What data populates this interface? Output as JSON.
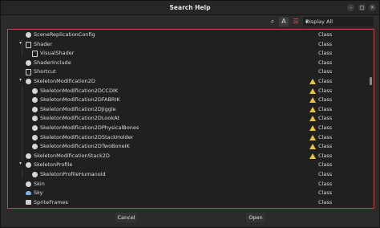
{
  "window": {
    "title": "Search Help",
    "minimize": "–",
    "maximize": "□",
    "close": "×"
  },
  "toolbar": {
    "display_value": "Display All",
    "arrow": "▾"
  },
  "rows": [
    {
      "label": "SceneReplicationConfig",
      "type": "Class",
      "warn": false,
      "icon": "node"
    },
    {
      "label": "Shader",
      "type": "Class",
      "warn": false,
      "icon": "doc",
      "expander": "▾"
    },
    {
      "label": "VisualShader",
      "type": "Class",
      "warn": false,
      "icon": "doc"
    },
    {
      "label": "ShaderInclude",
      "type": "Class",
      "warn": false,
      "icon": "node"
    },
    {
      "label": "Shortcut",
      "type": "Class",
      "warn": false,
      "icon": "doc"
    },
    {
      "label": "SkeletonModification2D",
      "type": "Class",
      "warn": true,
      "icon": "node",
      "expander": "▾"
    },
    {
      "label": "SkeletonModification2DCCDIK",
      "type": "Class",
      "warn": true,
      "icon": "node"
    },
    {
      "label": "SkeletonModification2DFABRIK",
      "type": "Class",
      "warn": true,
      "icon": "node"
    },
    {
      "label": "SkeletonModification2DJiggle",
      "type": "Class",
      "warn": true,
      "icon": "node"
    },
    {
      "label": "SkeletonModification2DLookAt",
      "type": "Class",
      "warn": true,
      "icon": "node"
    },
    {
      "label": "SkeletonModification2DPhysicalBones",
      "type": "Class",
      "warn": true,
      "icon": "node"
    },
    {
      "label": "SkeletonModification2DStackHolder",
      "type": "Class",
      "warn": true,
      "icon": "node"
    },
    {
      "label": "SkeletonModification2DTwoBoneIK",
      "type": "Class",
      "warn": true,
      "icon": "node"
    },
    {
      "label": "SkeletonModificationStack2D",
      "type": "Class",
      "warn": true,
      "icon": "node"
    },
    {
      "label": "SkeletonProfile",
      "type": "Class",
      "warn": false,
      "icon": "node",
      "expander": "▾"
    },
    {
      "label": "SkeletonProfileHumanoid",
      "type": "Class",
      "warn": false,
      "icon": "node"
    },
    {
      "label": "Skin",
      "type": "Class",
      "warn": false,
      "icon": "node"
    },
    {
      "label": "Sky",
      "type": "Class",
      "warn": false,
      "icon": "cloud"
    },
    {
      "label": "SpriteFrames",
      "type": "Class",
      "warn": false,
      "icon": "film"
    }
  ],
  "footer": {
    "cancel": "Cancel",
    "open": "Open"
  }
}
